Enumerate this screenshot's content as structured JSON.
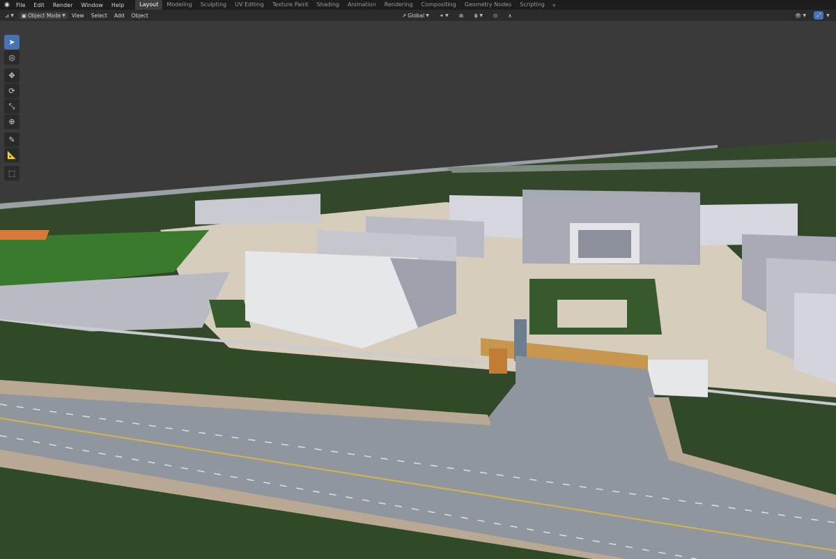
{
  "topbar": {
    "logo_icon": "blender-logo-icon",
    "menus": [
      "File",
      "Edit",
      "Render",
      "Window",
      "Help"
    ],
    "workspace_tabs": [
      "Layout",
      "Modeling",
      "Sculpting",
      "UV Editing",
      "Texture Paint",
      "Shading",
      "Animation",
      "Rendering",
      "Compositing",
      "Geometry Nodes",
      "Scripting"
    ],
    "active_tab": "Layout",
    "add_tab": "+"
  },
  "header": {
    "editor_type_icon": "3d-viewport-icon",
    "mode_label": "Object Mode",
    "menus": [
      "View",
      "Select",
      "Add",
      "Object"
    ],
    "transform_orientation": "Global"
  },
  "colors": {
    "accent": "#4772b3",
    "topbar_bg": "#1d1d1d",
    "header_bg": "#2b2b2b",
    "viewport_bg": "#3a3a3a",
    "grass": "#2f4a25",
    "road": "#8a9098",
    "building": "#c8cad2"
  },
  "tools": [
    {
      "name": "select-box-tool",
      "icon": "cursor-arrow-icon",
      "glyph": "➤",
      "active": true
    },
    {
      "name": "cursor-tool",
      "icon": "3d-cursor-icon",
      "glyph": "◎",
      "active": false
    },
    {
      "name": "move-tool",
      "icon": "move-arrows-icon",
      "glyph": "✥",
      "active": false
    },
    {
      "name": "rotate-tool",
      "icon": "rotate-icon",
      "glyph": "⟳",
      "active": false
    },
    {
      "name": "scale-tool",
      "icon": "scale-icon",
      "glyph": "⤡",
      "active": false
    },
    {
      "name": "transform-tool",
      "icon": "transform-icon",
      "glyph": "⊕",
      "active": false
    },
    {
      "name": "annotate-tool",
      "icon": "pencil-icon",
      "glyph": "✎",
      "active": false
    },
    {
      "name": "measure-tool",
      "icon": "ruler-icon",
      "glyph": "📐",
      "active": false
    },
    {
      "name": "add-cube-tool",
      "icon": "add-cube-icon",
      "glyph": "⬚",
      "active": false
    }
  ]
}
